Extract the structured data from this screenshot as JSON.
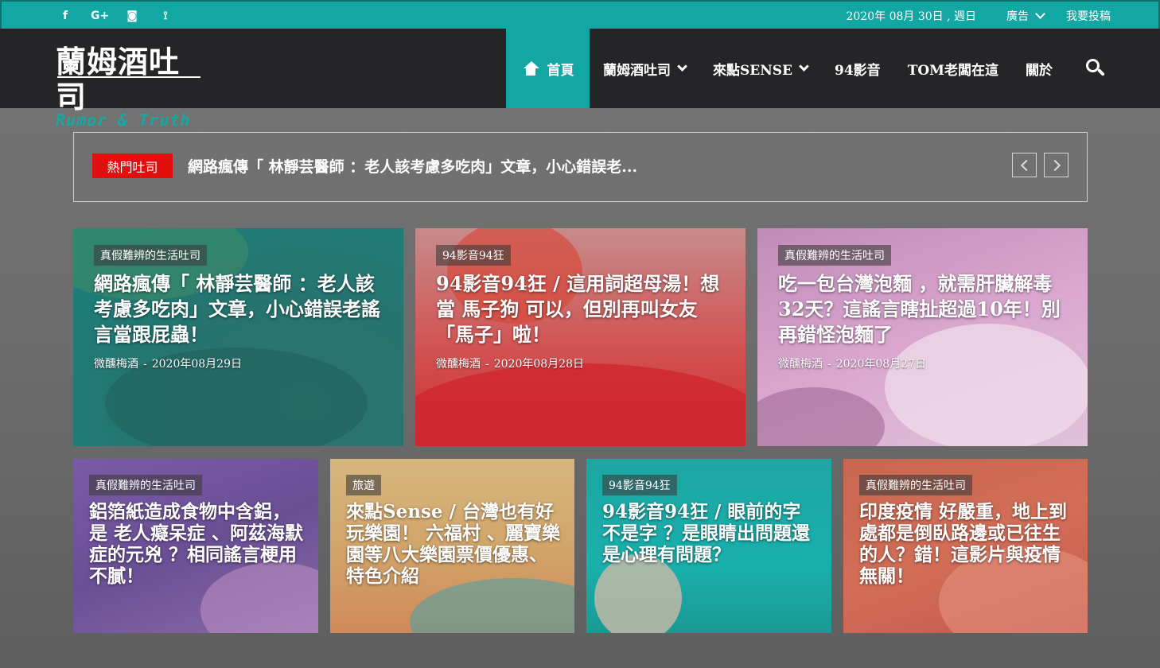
{
  "topbar": {
    "social": [
      {
        "icon": "facebook-icon",
        "glyph": "f"
      },
      {
        "icon": "google-plus-icon",
        "glyph": "G+"
      },
      {
        "icon": "instagram-icon",
        "glyph": "◙"
      },
      {
        "icon": "rss-icon",
        "glyph": "⟟"
      }
    ],
    "date": "2020年 08月 30日 , 週日",
    "ad_label": "廣告",
    "submit_label": "我要投稿"
  },
  "header": {
    "logo_cn": "蘭姆酒吐司",
    "logo_en": "Rumor & Truth",
    "nav": {
      "home": "首頁",
      "rum_toast": "蘭姆酒吐司",
      "sense": "來點SENSE",
      "video": "94影音",
      "tom": "TOM老闆在這",
      "about": "關於"
    }
  },
  "ticker": {
    "label": "熱門吐司",
    "headline": "網路瘋傳「 林靜芸醫師 ：老人該考慮多吃肉」文章，小心錯誤老..."
  },
  "colors": {
    "accent": "#13a7a3",
    "header_bg": "#252527",
    "ticker_label": "#e30f0f"
  },
  "cards": [
    {
      "category": "真假難辨的生活吐司",
      "title": "網路瘋傳「 林靜芸醫師 ：老人該考慮多吃肉」文章，小心錯誤老謠言當跟屁蟲！",
      "author": "微醺梅酒",
      "date": "2020年08月29日"
    },
    {
      "category": "94影音94狂",
      "title": "94影音94狂 / 這用詞超母湯！想當 馬子狗 可以，但別再叫女友「馬子」啦！",
      "author": "微醺梅酒",
      "date": "2020年08月28日"
    },
    {
      "category": "真假難辨的生活吐司",
      "title": "吃一包台灣泡麵 ，就需肝臟解毒32天？這謠言瞎扯超過10年！別再錯怪泡麵了",
      "author": "微醺梅酒",
      "date": "2020年08月27日"
    },
    {
      "category": "真假難辨的生活吐司",
      "title": "鋁箔紙造成食物中含鋁，是 老人癡呆症 、阿茲海默症的元兇 ？相同謠言梗用不膩！"
    },
    {
      "category": "旅遊",
      "title": "來點Sense / 台灣也有好玩樂園！ 六福村 、麗寶樂園等八大樂園票價優惠、特色介紹"
    },
    {
      "category": "94影音94狂",
      "title": "94影音94狂 / 眼前的字不是字 ？是眼睛出問題還是心理有問題？"
    },
    {
      "category": "真假難辨的生活吐司",
      "title": "印度疫情 好嚴重，地上到處都是倒臥路邊或已往生的人？錯！這影片與疫情無關！"
    }
  ]
}
